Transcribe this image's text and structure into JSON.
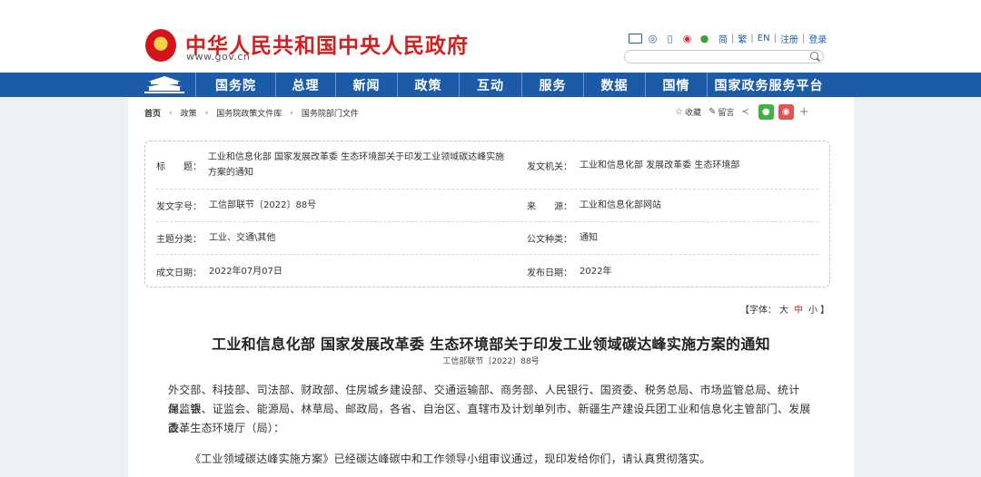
{
  "header": {
    "site_title": "中华人民共和国中央人民政府",
    "site_url": "www.gov.cn",
    "icons": [
      "mail-icon",
      "chat-icon",
      "phone-icon",
      "weibo-icon",
      "wechat-icon"
    ],
    "links": [
      "简",
      "繁",
      "EN",
      "注册",
      "登录"
    ],
    "search_placeholder": ""
  },
  "nav": {
    "items": [
      "国务院",
      "总理",
      "新闻",
      "政策",
      "互动",
      "服务",
      "数据",
      "国情",
      "国家政务服务平台"
    ]
  },
  "breadcrumb": [
    "首页",
    "政策",
    "国务院政策文件库",
    "国务院部门文件"
  ],
  "tools": {
    "collect": "收藏",
    "comment": "留言"
  },
  "info": {
    "title_label": "标　　题：",
    "title_value": "工业和信息化部 国家发展改革委 生态环境部关于印发工业领域碳达峰实施方案的通知",
    "issuer_label": "发文机关：",
    "issuer_value": "工业和信息化部 发展改革委 生态环境部",
    "docno_label": "发文字号：",
    "docno_value": "工信部联节〔2022〕88号",
    "source_label": "来　　源：",
    "source_value": "工业和信息化部网站",
    "topic_label": "主题分类：",
    "topic_value": "工业、交通\\其他",
    "doctype_label": "公文种类：",
    "doctype_value": "通知",
    "written_label": "成文日期：",
    "written_value": "2022年07月07日",
    "published_label": "发布日期：",
    "published_value": "2022年"
  },
  "font_size": {
    "prefix": "【字体：",
    "large": "大",
    "medium": "中",
    "small": "小",
    "suffix": "】"
  },
  "article": {
    "title": "工业和信息化部 国家发展改革委 生态环境部关于印发工业领域碳达峰实施方案的通知",
    "doc_number": "工信部联节〔2022〕88号",
    "line1": "外交部、科技部、司法部、财政部、住房城乡建设部、交通运输部、商务部、人民银行、国资委、税务总局、市场监管总局、统计局、银",
    "line2": "保监会、证监会、能源局、林草局、邮政局，各省、自治区、直辖市及计划单列市、新疆生产建设兵团工业和信息化主管部门、发展改革",
    "line3": "委、生态环境厅（局）：",
    "line4": "《工业领域碳达峰实施方案》已经碳达峰碳中和工作领导小组审议通过，现印发给你们，请认真贯彻落实。"
  },
  "colors": {
    "brand_red": "#d41f1f",
    "nav_blue": "#1c5ba8",
    "link_blue": "#1f5fa8"
  }
}
